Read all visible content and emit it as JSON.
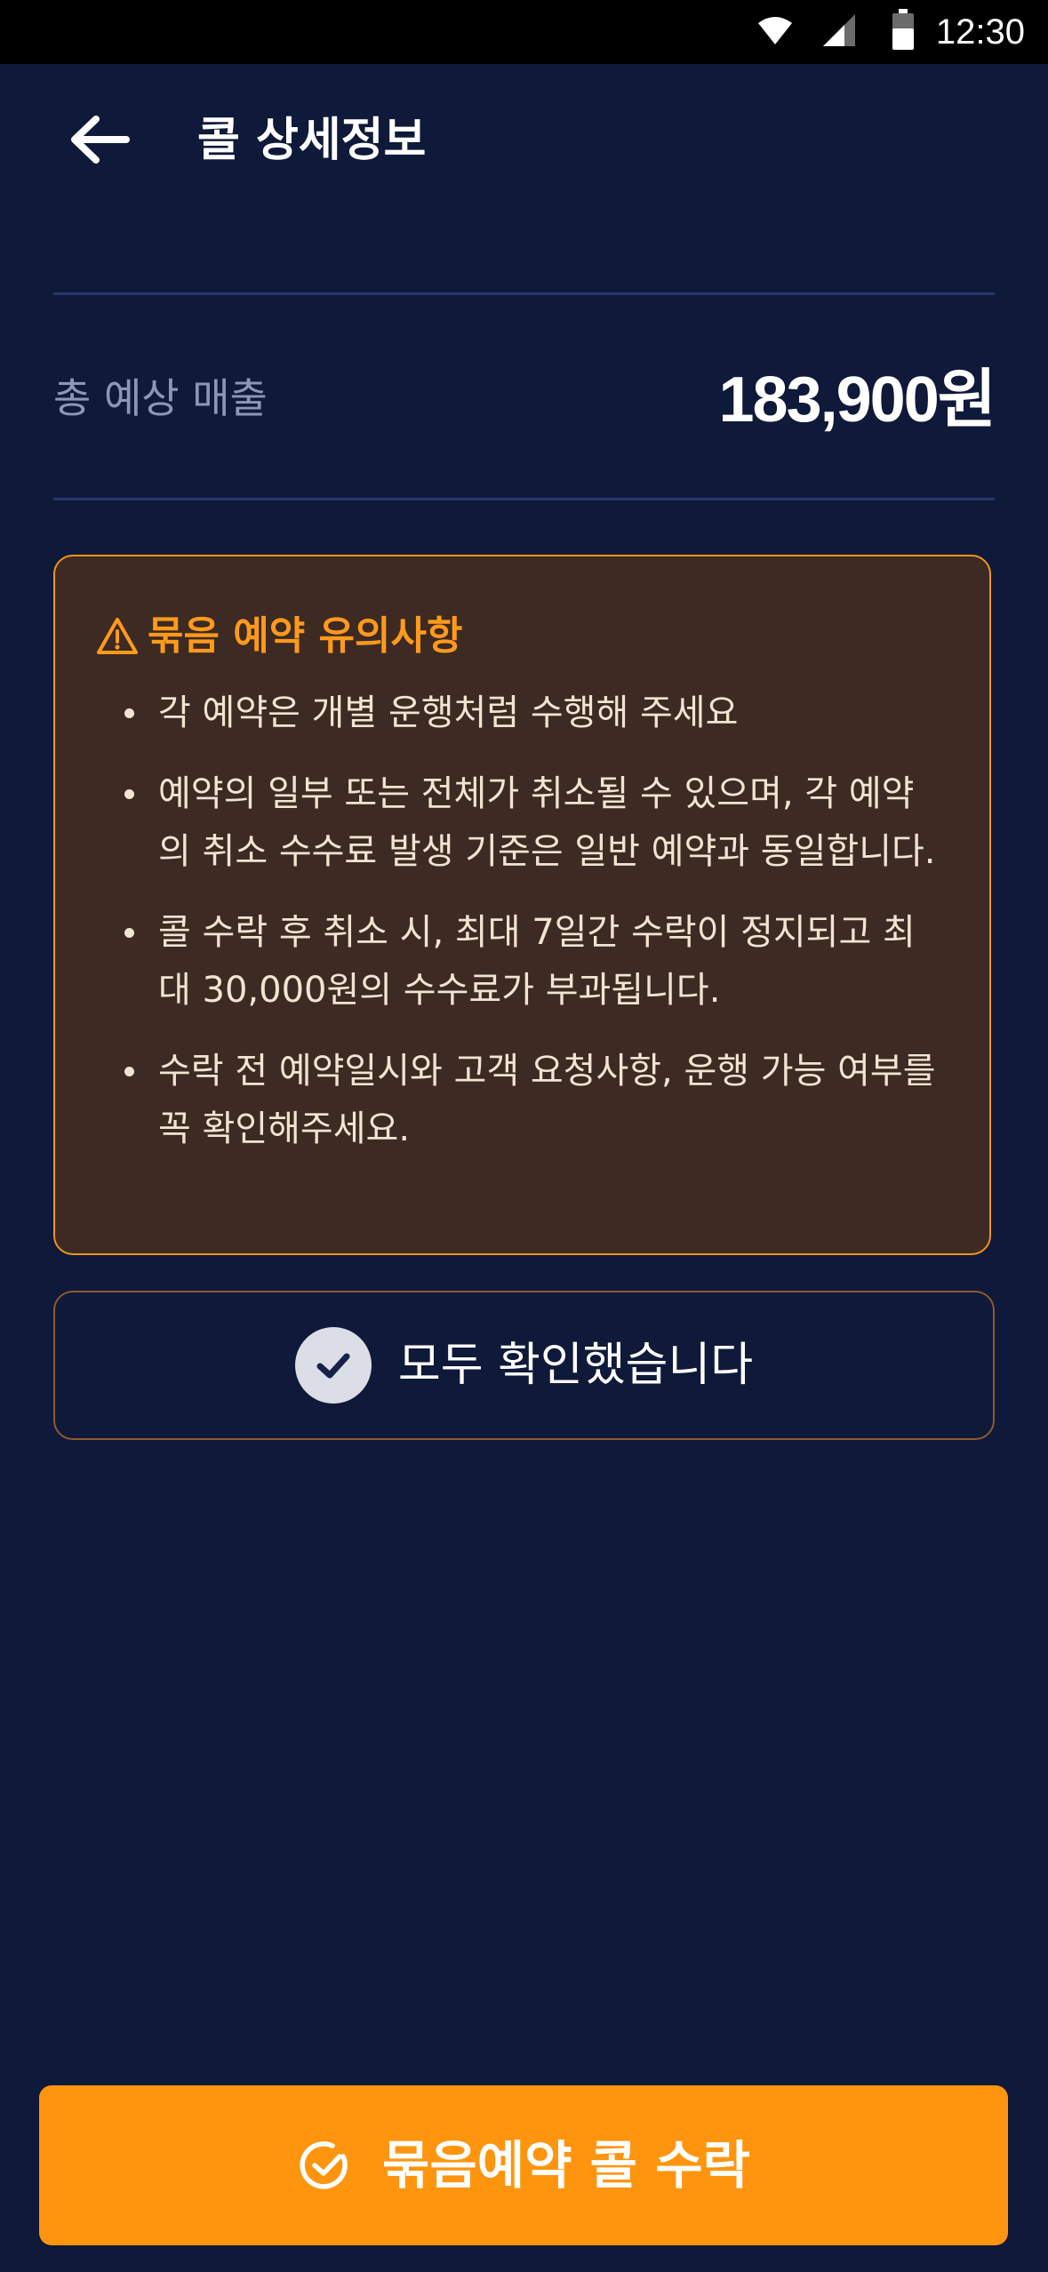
{
  "status_bar": {
    "time": "12:30",
    "icons": [
      "wifi-icon",
      "cellular-signal-icon",
      "battery-icon"
    ]
  },
  "header": {
    "back_icon": "arrow-left-icon",
    "title": "콜 상세정보"
  },
  "revenue": {
    "label": "총 예상 매출",
    "value": "183,900원"
  },
  "notice": {
    "icon": "warning-triangle-icon",
    "title": "묶음 예약 유의사항",
    "items": [
      "각 예약은 개별 운행처럼 수행해 주세요",
      "예약의 일부 또는 전체가 취소될 수 있으며, 각 예약의 취소 수수료 발생 기준은 일반 예약과 동일합니다.",
      "콜 수락 후 취소 시, 최대 7일간 수락이 정지되고 최대 30,000원의 수수료가 부과됩니다.",
      "수락 전 예약일시와 고객 요청사항, 운행 가능 여부를 꼭 확인해주세요."
    ]
  },
  "confirm": {
    "icon": "check-circle-icon",
    "label": "모두 확인했습니다"
  },
  "accept": {
    "icon": "check-circle-outline-icon",
    "label": "묶음예약 콜 수락"
  },
  "colors": {
    "background": "#0f1939",
    "accent": "#ff950e",
    "notice_bg": "#3d2a22",
    "notice_title": "#ff9a1c"
  }
}
